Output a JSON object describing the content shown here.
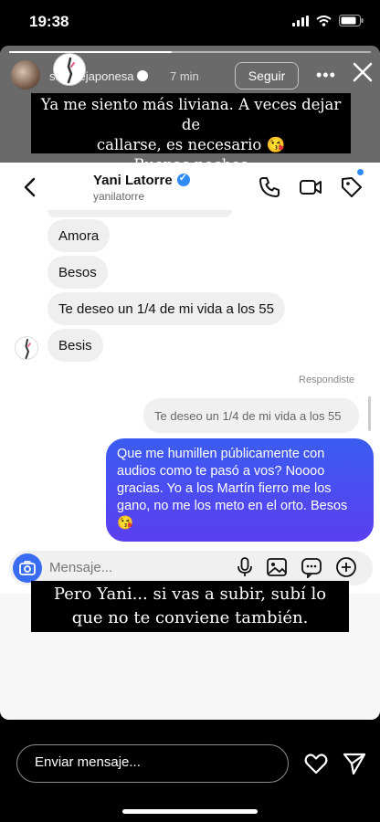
{
  "status_bar": {
    "time": "19:38"
  },
  "story": {
    "username": "sangrejaponesa",
    "time_ago": "7 min",
    "follow_label": "Seguir",
    "progress": 0.45,
    "caption_top_line1": "Ya me siento más liviana. A veces dejar de",
    "caption_top_line2": "callarse, es necesario 😘",
    "caption_top_line3": "Buenas noches",
    "caption_bottom_line1": "Pero Yani... si vas a subir, subí lo",
    "caption_bottom_line2": "que no te conviene también."
  },
  "dm": {
    "name": "Yani Latorre",
    "username": "yanilatorre",
    "messages_in": [
      "Amora",
      "Besos",
      "Te deseo un 1/4 de mi vida a los 55",
      "Besis"
    ],
    "replied_label": "Respondiste",
    "quoted": "Te deseo un 1/4 de mi vida a los 55",
    "outgoing": "Que me humillen públicamente con audios como te pasó a vos? Noooo gracias. Yo a los Martín fierro me los gano, no me los meto en el orto. Besos 😘",
    "compose_placeholder": "Mensaje..."
  },
  "reply": {
    "placeholder": "Enviar mensaje..."
  },
  "icons": [
    "wifi-icon",
    "signal-icon",
    "battery-icon",
    "close-icon",
    "more-icon",
    "back-icon",
    "phone-icon",
    "video-icon",
    "tag-icon",
    "camera-icon",
    "mic-icon",
    "image-icon",
    "sticker-icon",
    "plus-icon",
    "heart-icon",
    "send-icon"
  ],
  "colors": {
    "accent_blue": "#3a6cf2",
    "outgoing_start": "#3b5cf0",
    "outgoing_end": "#5b3ff0",
    "verified": "#2f8cf6"
  }
}
